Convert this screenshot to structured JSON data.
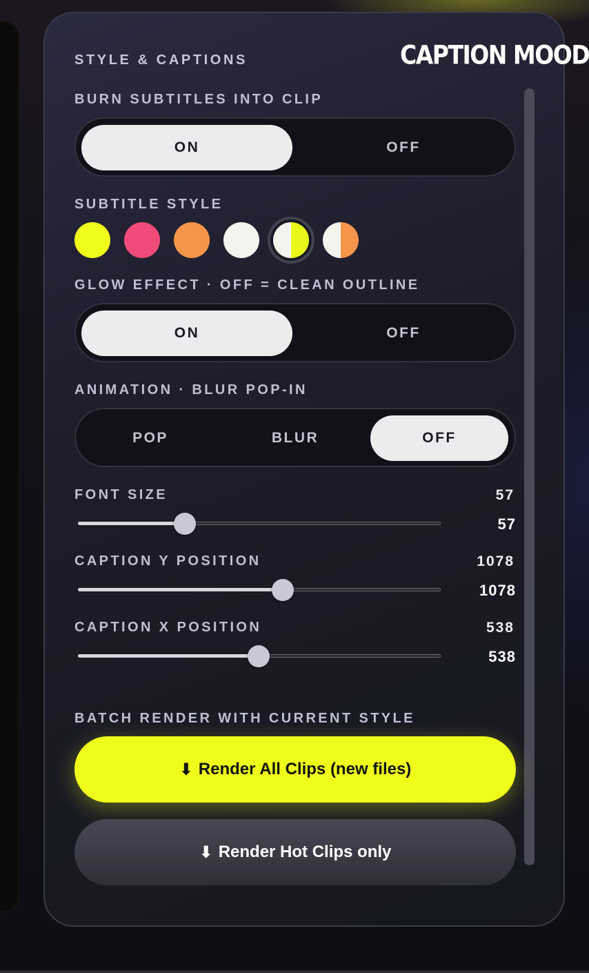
{
  "panel": {
    "title": "STYLE & CAPTIONS",
    "brand": "CAPTION MOOD"
  },
  "burn_subtitles": {
    "label": "BURN SUBTITLES INTO CLIP",
    "options": [
      "ON",
      "OFF"
    ],
    "selected": "ON"
  },
  "subtitle_style": {
    "label": "SUBTITLE STYLE",
    "swatches": [
      {
        "name": "yellow",
        "colors": [
          "#eefd1a"
        ]
      },
      {
        "name": "pink",
        "colors": [
          "#f04b78"
        ]
      },
      {
        "name": "orange",
        "colors": [
          "#f3954a"
        ]
      },
      {
        "name": "white",
        "colors": [
          "#f4f4ee"
        ]
      },
      {
        "name": "white-yellow",
        "colors": [
          "#f4f4ee",
          "#e8f81a"
        ],
        "selected": true
      },
      {
        "name": "white-orange",
        "colors": [
          "#f4f4ee",
          "#f3954a"
        ]
      }
    ]
  },
  "glow_effect": {
    "label": "GLOW EFFECT · OFF = CLEAN OUTLINE",
    "options": [
      "ON",
      "OFF"
    ],
    "selected": "ON"
  },
  "animation": {
    "label": "ANIMATION · BLUR POP-IN",
    "options": [
      "POP",
      "BLUR",
      "OFF"
    ],
    "selected": "OFF"
  },
  "font_size": {
    "label": "FONT SIZE",
    "value": "57",
    "input_value": "57",
    "fraction": 0.295
  },
  "caption_y": {
    "label": "CAPTION Y POSITION",
    "value": "1078",
    "input_value": "1078",
    "fraction": 0.565
  },
  "caption_x": {
    "label": "CAPTION X POSITION",
    "value": "538",
    "input_value": "538",
    "fraction": 0.498
  },
  "batch": {
    "label": "BATCH RENDER WITH CURRENT STYLE",
    "render_all": "Render All Clips (new files)",
    "render_hot": "Render Hot Clips only",
    "download_glyph": "⬇"
  },
  "colors": {
    "accent": "#eefd1a",
    "panel_bg": "#1f1e2c",
    "toggle_active": "#ececef"
  }
}
